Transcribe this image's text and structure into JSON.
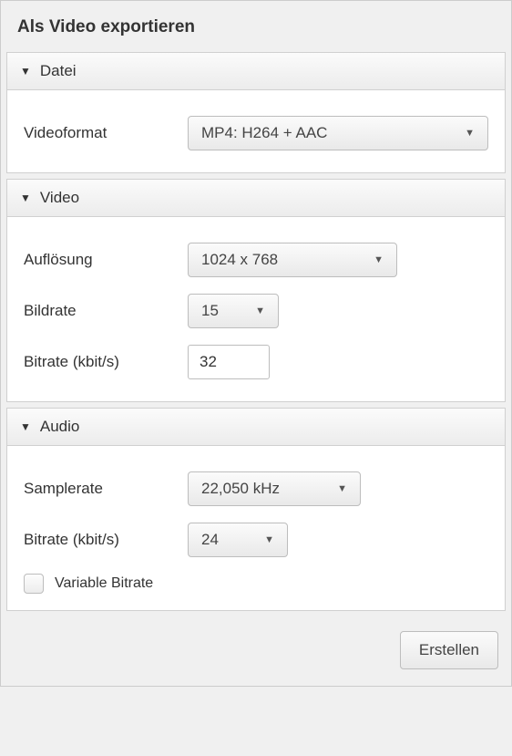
{
  "window": {
    "title": "Als Video exportieren"
  },
  "sections": {
    "datei": {
      "title": "Datei",
      "videoformat": {
        "label": "Videoformat",
        "value": "MP4: H264 + AAC"
      }
    },
    "video": {
      "title": "Video",
      "aufloesung": {
        "label": "Auflösung",
        "value": "1024 x 768"
      },
      "bildrate": {
        "label": "Bildrate",
        "value": "15"
      },
      "bitrate": {
        "label": "Bitrate (kbit/s)",
        "value": "32"
      }
    },
    "audio": {
      "title": "Audio",
      "samplerate": {
        "label": "Samplerate",
        "value": "22,050 kHz"
      },
      "bitrate": {
        "label": "Bitrate (kbit/s)",
        "value": "24"
      },
      "variable_bitrate": {
        "label": "Variable Bitrate",
        "checked": false
      }
    }
  },
  "footer": {
    "create_label": "Erstellen"
  }
}
